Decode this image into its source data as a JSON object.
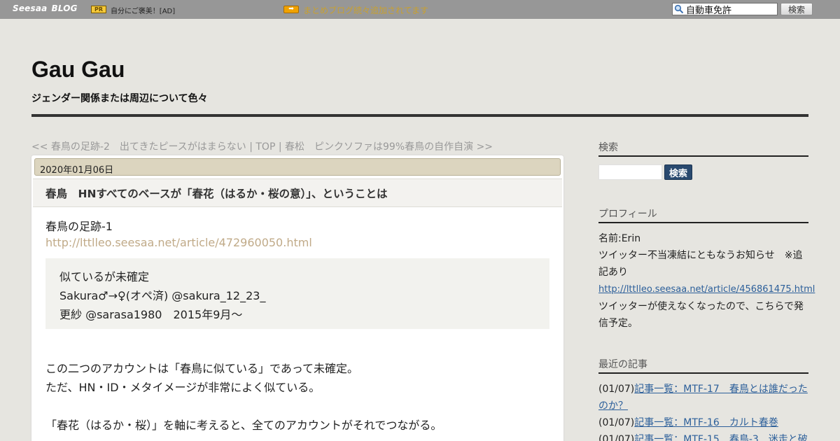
{
  "topbar": {
    "logo_seesaa": "Seesaa",
    "logo_blog": "BLOG",
    "pr_badge": "PR",
    "pr_text": "自分にご褒美！[AD]",
    "news_icon": "arrow-right-icon",
    "news_text": "まとめブログ続々追加されてます",
    "search_value": "自動車免許",
    "search_button": "検索"
  },
  "header": {
    "title": "Gau Gau",
    "description": "ジェンダー関係または周辺について色々"
  },
  "pager": {
    "prev": "<< 春鳥の足跡-2　出てきたピースがはまらない",
    "sep1": " | ",
    "top": "TOP",
    "sep2": " | ",
    "next": "春松　ピンクソファは99%春鳥の自作自演 >>"
  },
  "article": {
    "date": "2020年01月06日",
    "title": "春鳥　HNすべてのベースが「春花（はるか・桜の意）」、ということは",
    "intro": "春鳥の足跡-1",
    "intro_link": "http://lttlleo.seesaa.net/article/472960050.html",
    "quote": [
      "似ているが未確定",
      "Sakura♂→♀(オペ済) @sakura_12_23_",
      "更紗 @sarasa1980　2015年9月～"
    ],
    "paragraphs": [
      "この二つのアカウントは「春鳥に似ている」であって未確定。",
      "ただ、HN・ID・メタイメージが非常によく似ている。",
      "「春花（はるか・桜）」を軸に考えると、全てのアカウントがそれでつながる。"
    ]
  },
  "sidebar": {
    "search": {
      "heading": "検索",
      "button": "検索"
    },
    "profile": {
      "heading": "プロフィール",
      "name": "名前:Erin",
      "notice_line1": "ツイッター不当凍結にともなうお知らせ　※追",
      "notice_line2": "記あり",
      "notice_link": "http://lttlleo.seesaa.net/article/456861475.html",
      "after_line1": "ツイッターが使えなくなったので、こちらで発",
      "after_line2": "信予定。"
    },
    "recent": {
      "heading": "最近の記事",
      "items": [
        {
          "date": "(01/07)",
          "title_line1": "記事一覧：MTF-17　春鳥とは誰だった",
          "title_line2": "のか？"
        },
        {
          "date": "(01/07)",
          "title_line1": "記事一覧：MTF-16　カルト春巻",
          "title_line2": ""
        },
        {
          "date": "(01/07)",
          "title_line1": "記事一覧：MTF-15　春鳥-3　迷走と破",
          "title_line2": ""
        }
      ]
    }
  },
  "colors": {
    "topbar_bg": "#979797",
    "page_bg": "#e6e5e0",
    "link": "#2c5f9a",
    "muted_link": "#c0aa88",
    "date_bar": "#dcd5bf",
    "search_button": "#29496f"
  }
}
